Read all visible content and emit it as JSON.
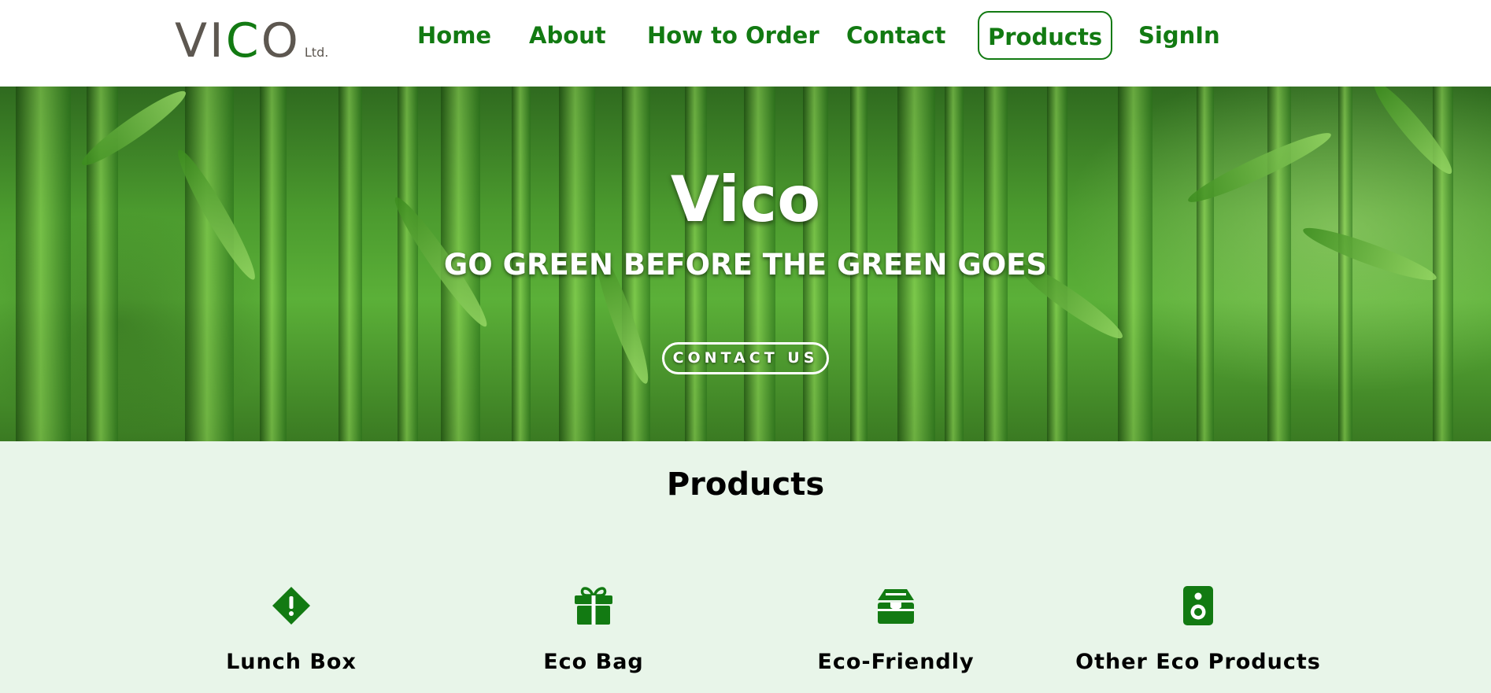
{
  "brand": {
    "logo_pre": "VI",
    "logo_mid": "C",
    "logo_post": "O",
    "logo_suffix": "Ltd.",
    "text_color": "#5d5750",
    "accent_color": "#127a12"
  },
  "nav": {
    "items": [
      {
        "label": "Home",
        "active": false
      },
      {
        "label": "About",
        "active": false
      },
      {
        "label": "How to Order",
        "active": false
      },
      {
        "label": "Contact",
        "active": false
      },
      {
        "label": "Products",
        "active": true
      },
      {
        "label": "SignIn",
        "active": false
      }
    ]
  },
  "hero": {
    "title": "Vico",
    "tagline": "GO GREEN BEFORE THE GREEN GOES",
    "button_label": "CONTACT US"
  },
  "products": {
    "title": "Products",
    "background": "#e8f5e9",
    "items": [
      {
        "name": "Lunch Box",
        "icon": "diamond-exclamation-icon"
      },
      {
        "name": "Eco Bag",
        "icon": "gift-icon"
      },
      {
        "name": "Eco-Friendly",
        "icon": "box-open-icon"
      },
      {
        "name": "Other Eco Products",
        "icon": "speaker-icon"
      }
    ]
  }
}
